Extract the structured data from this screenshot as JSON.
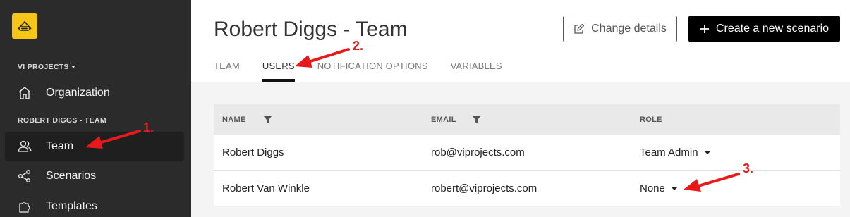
{
  "sidebar": {
    "logo_icon": "paperclip-logo-icon",
    "project_section": "VI PROJECTS",
    "team_section": "ROBERT DIGGS - TEAM",
    "items": [
      {
        "label": "Organization",
        "icon": "home-icon"
      },
      {
        "label": "Team",
        "icon": "users-icon",
        "active": true
      },
      {
        "label": "Scenarios",
        "icon": "share-icon"
      },
      {
        "label": "Templates",
        "icon": "puzzle-icon"
      }
    ]
  },
  "header": {
    "title": "Robert Diggs - Team",
    "change_details_label": "Change details",
    "create_scenario_label": "Create a new scenario"
  },
  "tabs": [
    {
      "label": "TEAM"
    },
    {
      "label": "USERS",
      "active": true
    },
    {
      "label": "NOTIFICATION OPTIONS"
    },
    {
      "label": "VARIABLES"
    }
  ],
  "table": {
    "columns": [
      "NAME",
      "EMAIL",
      "ROLE"
    ],
    "rows": [
      {
        "name": "Robert Diggs",
        "email": "rob@viprojects.com",
        "role": "Team Admin"
      },
      {
        "name": "Robert Van Winkle",
        "email": "robert@viprojects.com",
        "role": "None"
      }
    ]
  },
  "annotations": [
    "1.",
    "2.",
    "3."
  ],
  "colors": {
    "sidebar_bg": "#2b2b2b",
    "accent_yellow": "#f5c518",
    "annotation_red": "#e8191a"
  }
}
